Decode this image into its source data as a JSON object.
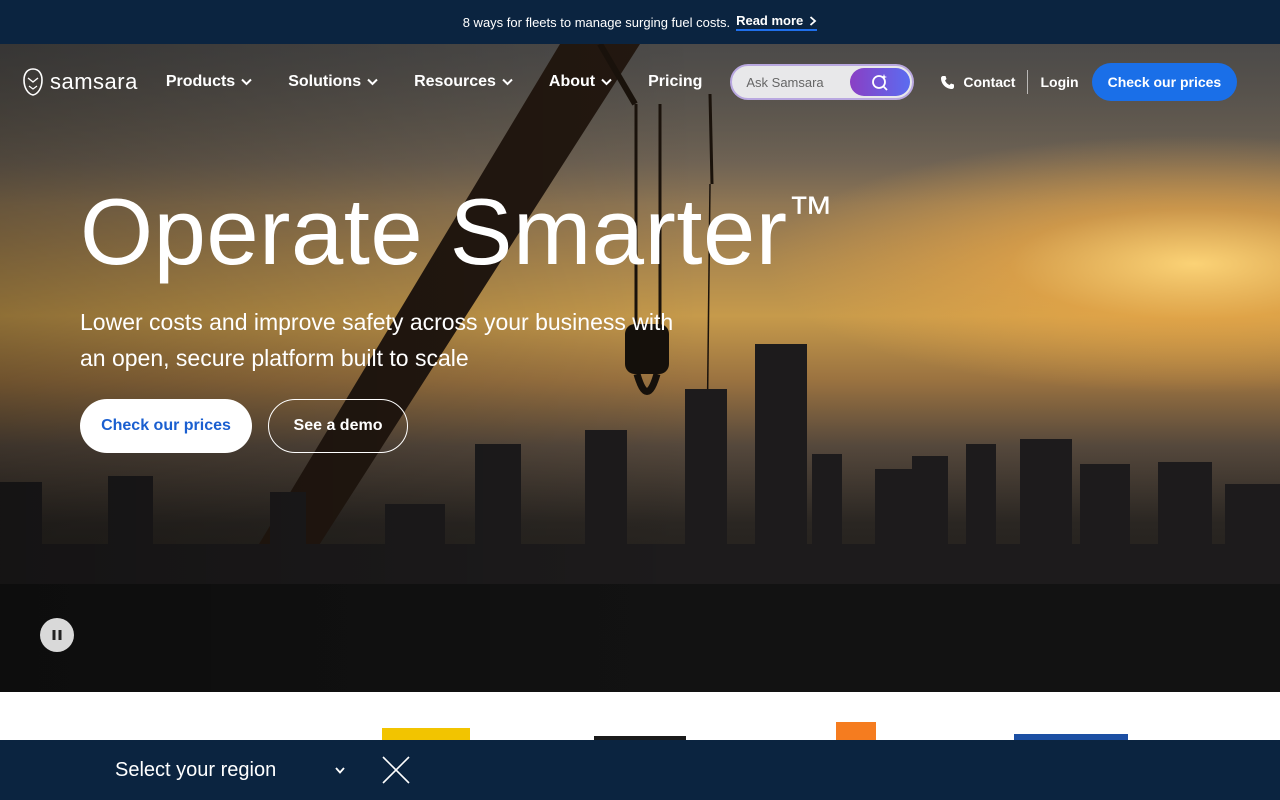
{
  "announcement": {
    "text": "8 ways for fleets to manage surging fuel costs.",
    "link_label": "Read more"
  },
  "nav": {
    "brand": "samsara",
    "menu": [
      {
        "label": "Products",
        "has_dropdown": true
      },
      {
        "label": "Solutions",
        "has_dropdown": true
      },
      {
        "label": "Resources",
        "has_dropdown": true
      },
      {
        "label": "About",
        "has_dropdown": true
      },
      {
        "label": "Pricing",
        "has_dropdown": false
      }
    ],
    "search_placeholder": "Ask Samsara",
    "contact_label": "Contact",
    "login_label": "Login",
    "cta_label": "Check our prices"
  },
  "hero": {
    "headline": "Operate Smarter",
    "trademark": "™",
    "subhead": "Lower costs and improve safety across your business with an open, secure platform built to scale",
    "primary_cta": "Check our prices",
    "secondary_cta": "See a demo"
  },
  "region_bar": {
    "label": "Select your region"
  },
  "colors": {
    "navy": "#0b2440",
    "brand_blue": "#1a6fe8",
    "search_gradient_start": "#8a3fc4",
    "search_gradient_end": "#5b6cf0"
  },
  "icons": [
    "samsara-logo-icon",
    "chevron-right-icon",
    "chevron-down-icon",
    "search-sparkle-icon",
    "phone-icon",
    "pause-icon",
    "close-icon"
  ]
}
